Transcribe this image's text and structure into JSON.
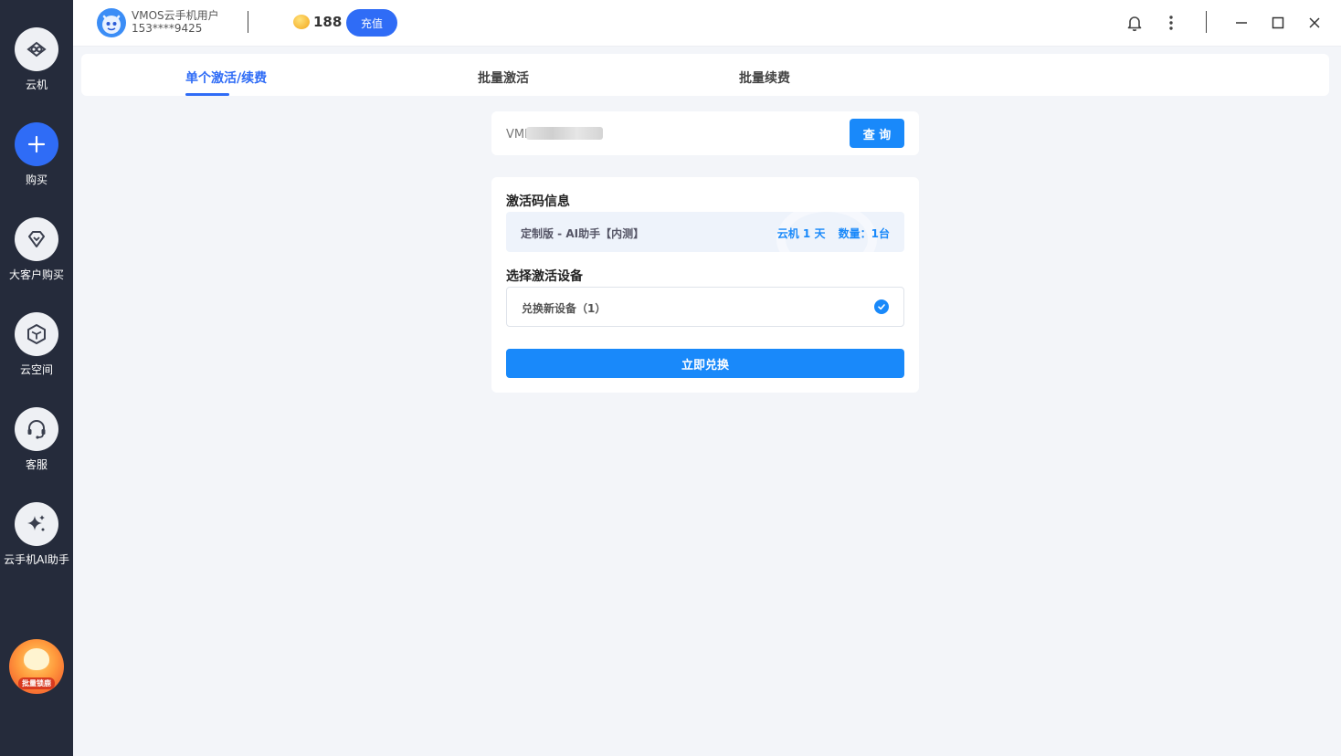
{
  "sidebar": {
    "items": [
      {
        "label": "云机",
        "icon": "cloud-phone-icon"
      },
      {
        "label": "购买",
        "icon": "plus-icon",
        "active": true
      },
      {
        "label": "大客户购买",
        "icon": "diamond-icon"
      },
      {
        "label": "云空间",
        "icon": "cube-icon"
      },
      {
        "label": "客服",
        "icon": "headset-icon"
      },
      {
        "label": "云手机AI助手",
        "icon": "sparkle-icon"
      }
    ],
    "promo_label": "批量锁鹿"
  },
  "topbar": {
    "user_name": "VMOS云手机用户",
    "user_phone": "153****9425",
    "coin_count": "188",
    "recharge_label": "充值"
  },
  "tabs": [
    {
      "label": "单个激活/续费",
      "active": true
    },
    {
      "label": "批量激活"
    },
    {
      "label": "批量续费"
    }
  ],
  "query": {
    "input_value": "VMI",
    "button_label": "查 询"
  },
  "activation_info": {
    "title": "激活码信息",
    "product_name": "定制版 - AI助手【内测】",
    "duration": "云机 1 天",
    "quantity": "数量：1台"
  },
  "device_select": {
    "title": "选择激活设备",
    "option_label": "兑换新设备（1）",
    "selected": true
  },
  "redeem_button_label": "立即兑换",
  "colors": {
    "sidebar_bg": "#252b3b",
    "primary": "#2f6cf6",
    "button_blue": "#1989fa",
    "page_bg": "#f3f5f9"
  }
}
